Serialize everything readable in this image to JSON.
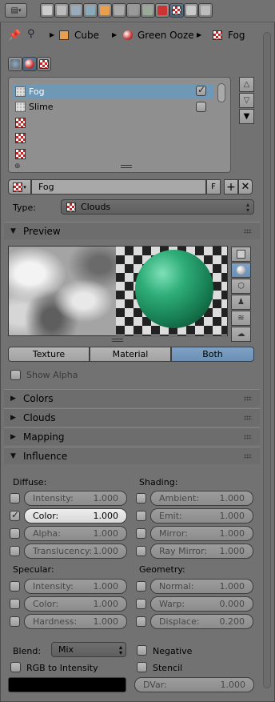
{
  "toolbar": {
    "editor_icon": "properties-editor-icon",
    "context_icons": [
      "render-icon",
      "render-layers-icon",
      "scene-icon",
      "world-icon",
      "object-icon",
      "constraints-icon",
      "modifiers-icon",
      "mesh-data-icon",
      "material-icon",
      "texture-icon",
      "particles-icon",
      "physics-icon"
    ]
  },
  "breadcrumb": {
    "items": [
      "Cube",
      "Green Ooze",
      "Fog"
    ]
  },
  "texture_slots": {
    "items": [
      {
        "label": "Fog",
        "enabled": true,
        "selected": true
      },
      {
        "label": "Slime",
        "enabled": false,
        "selected": false
      },
      {
        "label": "",
        "enabled": null,
        "selected": false
      },
      {
        "label": "",
        "enabled": null,
        "selected": false
      },
      {
        "label": "",
        "enabled": null,
        "selected": false
      }
    ]
  },
  "datablock": {
    "name": "Fog",
    "fake_user": "F"
  },
  "type_select": {
    "label": "Type:",
    "value": "Clouds"
  },
  "preview": {
    "header": "Preview",
    "modes": [
      "Texture",
      "Material",
      "Both"
    ],
    "selected_mode": "Both",
    "show_alpha": "Show Alpha"
  },
  "sections": {
    "colors": "Colors",
    "clouds": "Clouds",
    "mapping": "Mapping",
    "influence": "Influence"
  },
  "influence": {
    "diffuse_label": "Diffuse:",
    "shading_label": "Shading:",
    "specular_label": "Specular:",
    "geometry_label": "Geometry:",
    "diffuse": [
      {
        "label": "Intensity:",
        "value": "1.000",
        "enabled": false
      },
      {
        "label": "Color:",
        "value": "1.000",
        "enabled": true
      },
      {
        "label": "Alpha:",
        "value": "1.000",
        "enabled": false
      },
      {
        "label": "Translucency:",
        "value": "1.000",
        "enabled": false
      }
    ],
    "shading": [
      {
        "label": "Ambient:",
        "value": "1.000",
        "enabled": false
      },
      {
        "label": "Emit:",
        "value": "1.000",
        "enabled": false
      },
      {
        "label": "Mirror:",
        "value": "1.000",
        "enabled": false
      },
      {
        "label": "Ray Mirror:",
        "value": "1.000",
        "enabled": false
      }
    ],
    "specular": [
      {
        "label": "Intensity:",
        "value": "1.000",
        "enabled": false
      },
      {
        "label": "Color:",
        "value": "1.000",
        "enabled": false
      },
      {
        "label": "Hardness:",
        "value": "1.000",
        "enabled": false
      }
    ],
    "geometry": [
      {
        "label": "Normal:",
        "value": "1.000",
        "enabled": false
      },
      {
        "label": "Warp:",
        "value": "0.000",
        "enabled": false
      },
      {
        "label": "Displace:",
        "value": "0.200",
        "enabled": false
      }
    ],
    "blend_label": "Blend:",
    "blend_value": "Mix",
    "negative": "Negative",
    "rgb_to_intensity": "RGB to Intensity",
    "stencil": "Stencil",
    "dvar_label": "DVar:",
    "dvar_value": "1.000",
    "color_swatch": "#000000"
  },
  "colors": {
    "accent": "#6f97b6",
    "panel": "#727272",
    "header": "#6d6d6d"
  }
}
